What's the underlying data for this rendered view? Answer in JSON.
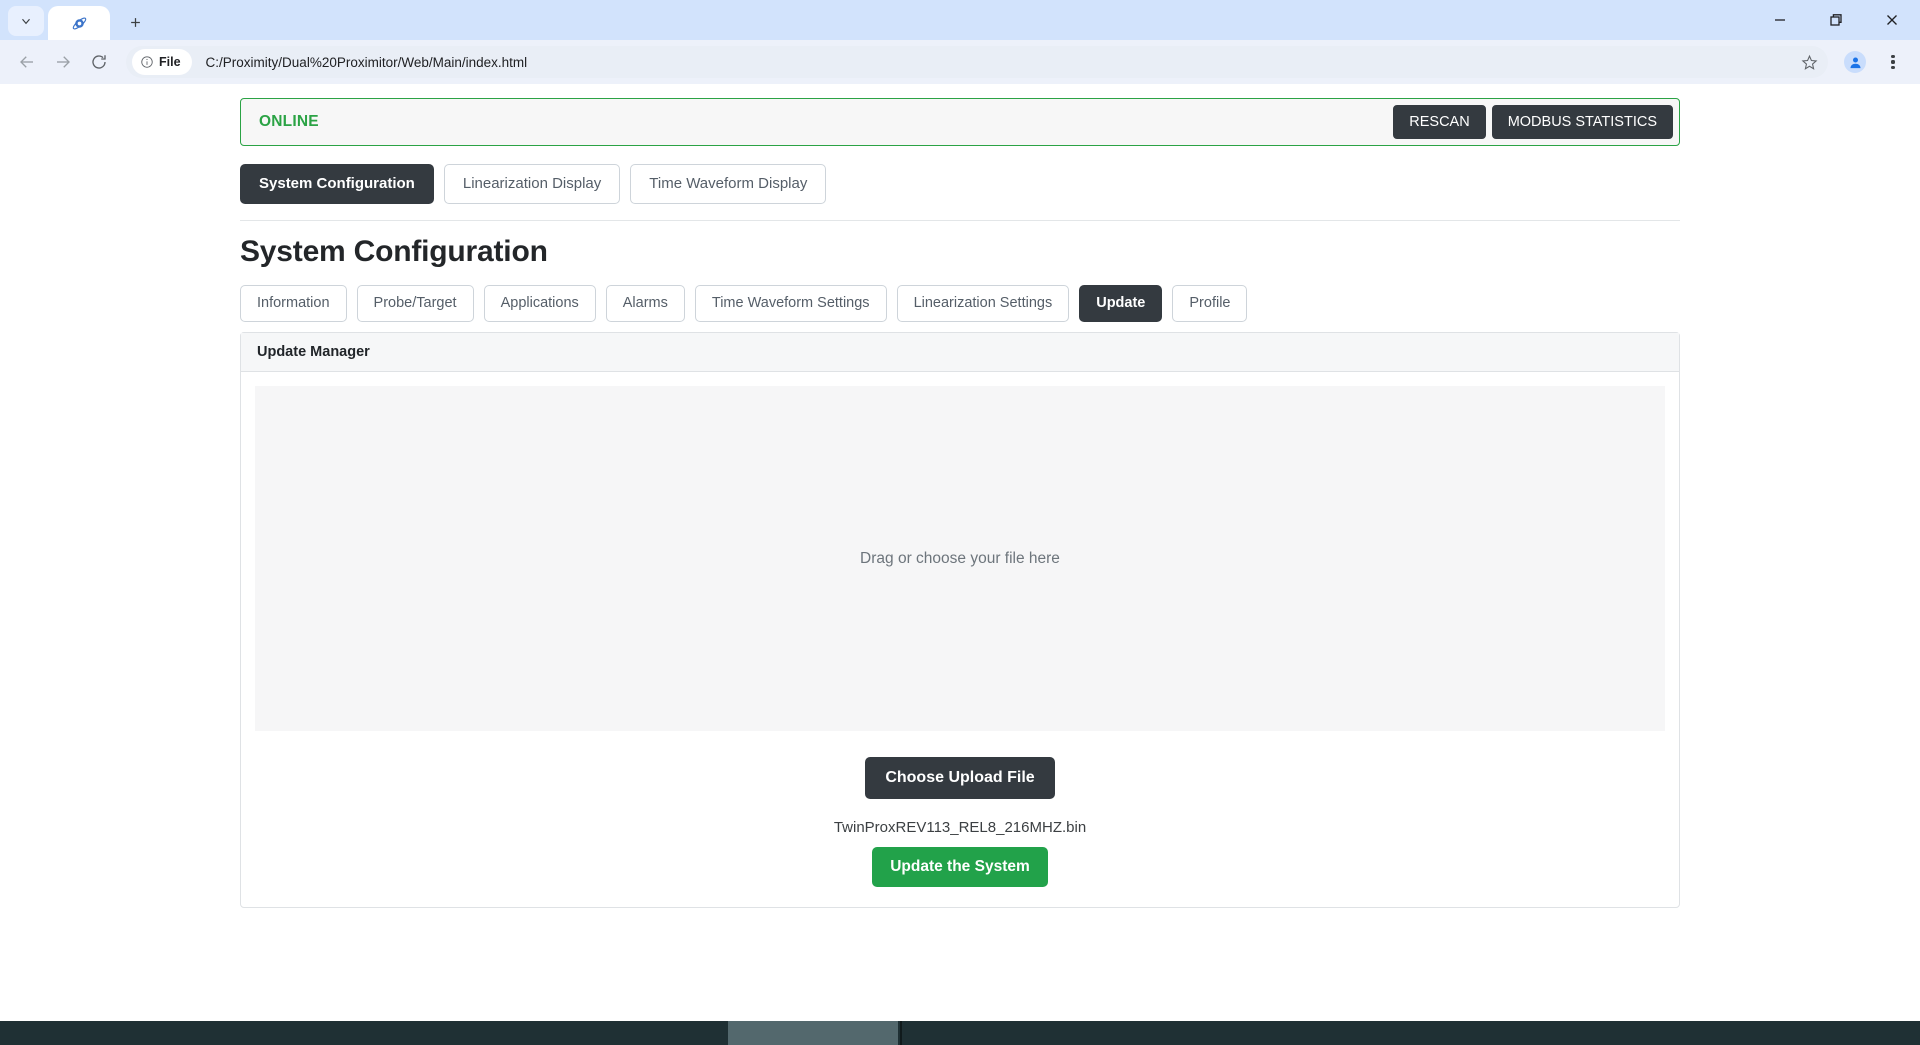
{
  "browser": {
    "tab": {
      "title": "",
      "favicon_icon": "globe-favicon"
    },
    "tab_list_icon": "chevron-down-icon",
    "newtab_icon": "plus-icon",
    "window_controls": {
      "minimize_icon": "minimize-icon",
      "maximize_icon": "restore-icon",
      "close_icon": "close-icon"
    },
    "toolbar": {
      "back_icon": "arrow-left-icon",
      "forward_icon": "arrow-right-icon",
      "reload_icon": "reload-icon",
      "file_chip_label": "File",
      "file_chip_icon": "info-circle-icon",
      "url": "C:/Proximity/Dual%20Proximitor/Web/Main/index.html",
      "bookmark_icon": "star-icon",
      "profile_icon": "person-icon",
      "menu_icon": "kebab-menu-icon"
    }
  },
  "status_bar": {
    "state_label": "ONLINE",
    "state_color": "#2ba345",
    "rescan_label": "RESCAN",
    "modbus_label": "MODBUS STATISTICS"
  },
  "main_tabs": [
    {
      "label": "System Configuration",
      "active": true
    },
    {
      "label": "Linearization Display",
      "active": false
    },
    {
      "label": "Time Waveform Display",
      "active": false
    }
  ],
  "page": {
    "title": "System Configuration"
  },
  "sub_tabs": [
    {
      "label": "Information",
      "active": false
    },
    {
      "label": "Probe/Target",
      "active": false
    },
    {
      "label": "Applications",
      "active": false
    },
    {
      "label": "Alarms",
      "active": false
    },
    {
      "label": "Time Waveform Settings",
      "active": false
    },
    {
      "label": "Linearization Settings",
      "active": false
    },
    {
      "label": "Update",
      "active": true
    },
    {
      "label": "Profile",
      "active": false
    }
  ],
  "update_panel": {
    "header": "Update Manager",
    "dropzone_text": "Drag or choose your file here",
    "choose_button": "Choose Upload File",
    "selected_file": "TwinProxREV113_REL8_216MHZ.bin",
    "update_button": "Update the System",
    "update_button_color": "#22a24a"
  }
}
